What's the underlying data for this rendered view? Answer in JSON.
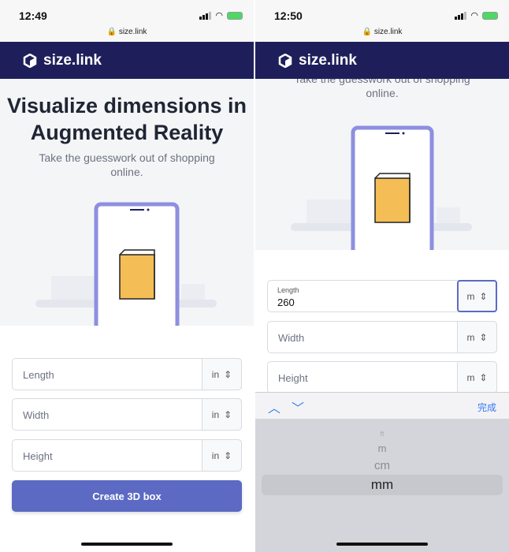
{
  "left": {
    "status": {
      "time": "12:49",
      "url": "size.link"
    },
    "brand": "size.link",
    "hero": {
      "title_line1": "Visualize dimensions in",
      "title_line2": "Augmented Reality",
      "subtitle_line1": "Take the guesswork out of shopping",
      "subtitle_line2": "online."
    },
    "fields": [
      {
        "placeholder": "Length",
        "unit": "in"
      },
      {
        "placeholder": "Width",
        "unit": "in"
      },
      {
        "placeholder": "Height",
        "unit": "in"
      }
    ],
    "create_button": "Create 3D box"
  },
  "right": {
    "status": {
      "time": "12:50",
      "url": "size.link"
    },
    "brand": "size.link",
    "hero": {
      "subtitle_line1": "Take the guesswork out of shopping",
      "subtitle_line2": "online."
    },
    "fields": [
      {
        "label": "Length",
        "value": "260",
        "unit": "m"
      },
      {
        "placeholder": "Width",
        "unit": "m"
      },
      {
        "placeholder": "Height",
        "unit": "m"
      }
    ],
    "keyboard": {
      "done": "完成",
      "options": [
        "ft",
        "m",
        "cm",
        "mm"
      ],
      "selected": "mm"
    }
  },
  "colors": {
    "nav": "#1e1f5a",
    "accent": "#5c6ac4",
    "box": "#f5bd55"
  }
}
